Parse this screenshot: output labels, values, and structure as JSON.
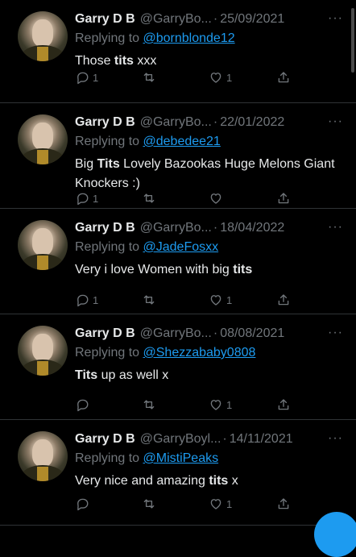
{
  "tweets": [
    {
      "name": "Garry D B",
      "handle": "@GarryBo...",
      "date": "25/09/2021",
      "replying_prefix": "Replying to",
      "replying_to": "@bornblonde12",
      "text_before": "Those ",
      "text_bold": "tits",
      "text_after": " xxx",
      "reply_count": "1",
      "retweet_count": "",
      "like_count": "1"
    },
    {
      "name": "Garry D B",
      "handle": "@GarryBo...",
      "date": "22/01/2022",
      "replying_prefix": "Replying to",
      "replying_to": "@debedee21",
      "text_before": "Big ",
      "text_bold": "Tits",
      "text_after": " Lovely Bazookas Huge Melons Giant Knockers :)",
      "reply_count": "1",
      "retweet_count": "",
      "like_count": ""
    },
    {
      "name": "Garry D B",
      "handle": "@GarryBo...",
      "date": "18/04/2022",
      "replying_prefix": "Replying to",
      "replying_to": "@JadeFosxx",
      "text_before": "Very i love Women with big ",
      "text_bold": "tits",
      "text_after": "",
      "reply_count": "1",
      "retweet_count": "",
      "like_count": "1"
    },
    {
      "name": "Garry D B",
      "handle": "@GarryBo...",
      "date": "08/08/2021",
      "replying_prefix": "Replying to",
      "replying_to": "@Shezzababy0808",
      "text_before": "",
      "text_bold": "Tits",
      "text_after": " up as well x",
      "reply_count": "",
      "retweet_count": "",
      "like_count": "1"
    },
    {
      "name": "Garry D B",
      "handle": "@GarryBoyl...",
      "date": "14/11/2021",
      "replying_prefix": "Replying to",
      "replying_to": "@MistiPeaks",
      "text_before": "Very nice and amazing ",
      "text_bold": "tits",
      "text_after": " x",
      "reply_count": "",
      "retweet_count": "",
      "like_count": "1"
    }
  ],
  "separator": "·",
  "more_label": "···",
  "colors": {
    "background": "#000000",
    "text": "#e7e9ea",
    "secondary": "#71767b",
    "accent": "#1d9bf0",
    "border": "#2f3336"
  },
  "icons": [
    "reply-icon",
    "retweet-icon",
    "like-icon",
    "share-icon",
    "more-icon"
  ]
}
